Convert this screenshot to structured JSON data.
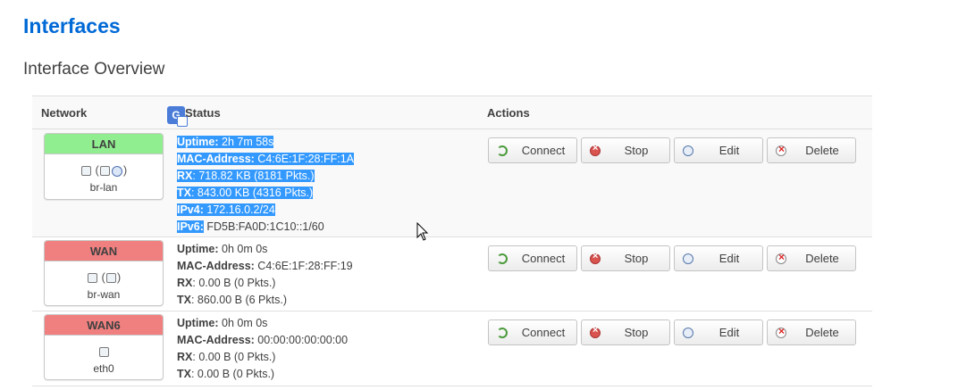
{
  "page": {
    "title": "Interfaces",
    "section_title": "Interface Overview"
  },
  "table": {
    "headers": {
      "network": "Network",
      "status": "Status",
      "actions": "Actions"
    },
    "labels": {
      "uptime": "Uptime:",
      "mac": "MAC-Address:",
      "rx": "RX",
      "tx": "TX",
      "ipv4": "IPv4:",
      "ipv6": "IPv6:"
    },
    "rows": [
      {
        "name": "LAN",
        "header_color": "#90ee90",
        "icons": [
          "switch-icon",
          "bridge-icon",
          "wireless-icon"
        ],
        "icon_paren_open": "(",
        "icon_paren_close": ")",
        "device": "br-lan",
        "uptime": "2h 7m 58s",
        "mac": "C4:6E:1F:28:FF:1A",
        "rx": ": 718.82 KB (8181 Pkts.)",
        "tx": ": 843.00 KB (4316 Pkts.)",
        "ipv4": "172.16.0.2/24",
        "ipv6": "FD5B:FA0D:1C10::1/60"
      },
      {
        "name": "WAN",
        "header_color": "#f08080",
        "icons": [
          "switch-icon",
          "bridge-icon"
        ],
        "icon_paren_open": "(",
        "icon_paren_close": ")",
        "device": "br-wan",
        "uptime": "0h 0m 0s",
        "mac": "C4:6E:1F:28:FF:19",
        "rx": ": 0.00 B (0 Pkts.)",
        "tx": ": 860.00 B (6 Pkts.)"
      },
      {
        "name": "WAN6",
        "header_color": "#f08080",
        "icons": [
          "ethernet-icon"
        ],
        "device": "eth0",
        "uptime": "0h 0m 0s",
        "mac": "00:00:00:00:00:00",
        "rx": ": 0.00 B (0 Pkts.)",
        "tx": ": 0.00 B (0 Pkts.)"
      }
    ]
  },
  "actions": {
    "connect": "Connect",
    "stop": "Stop",
    "edit": "Edit",
    "delete": "Delete"
  },
  "overlay": {
    "translate_icon_glyph": "G",
    "selection_color": "#3399ff"
  }
}
